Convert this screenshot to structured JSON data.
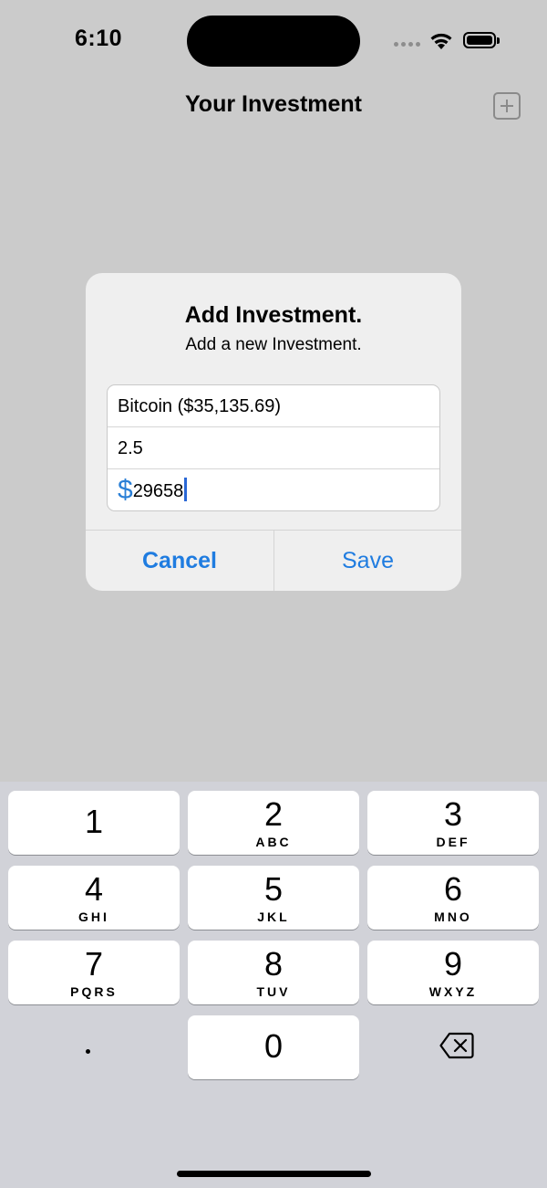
{
  "status": {
    "time": "6:10"
  },
  "nav": {
    "title": "Your Investment",
    "add_icon": "plus-square-icon"
  },
  "alert": {
    "title": "Add Investment.",
    "message": "Add a new Investment.",
    "fields": {
      "asset_value": "Bitcoin ($35,135.69)",
      "quantity_value": "2.5",
      "currency_symbol": "$",
      "amount_value": "29658"
    },
    "cancel_label": "Cancel",
    "save_label": "Save"
  },
  "keyboard": {
    "keys": [
      {
        "num": "1",
        "letters": ""
      },
      {
        "num": "2",
        "letters": "ABC"
      },
      {
        "num": "3",
        "letters": "DEF"
      },
      {
        "num": "4",
        "letters": "GHI"
      },
      {
        "num": "5",
        "letters": "JKL"
      },
      {
        "num": "6",
        "letters": "MNO"
      },
      {
        "num": "7",
        "letters": "PQRS"
      },
      {
        "num": "8",
        "letters": "TUV"
      },
      {
        "num": "9",
        "letters": "WXYZ"
      },
      {
        "num": "0",
        "letters": ""
      }
    ],
    "decimal": ".",
    "delete_icon": "backspace-icon"
  },
  "colors": {
    "accent": "#1f7ce0",
    "keyboard_bg": "#d1d2d8",
    "dim_bg": "#cbcbcb"
  }
}
